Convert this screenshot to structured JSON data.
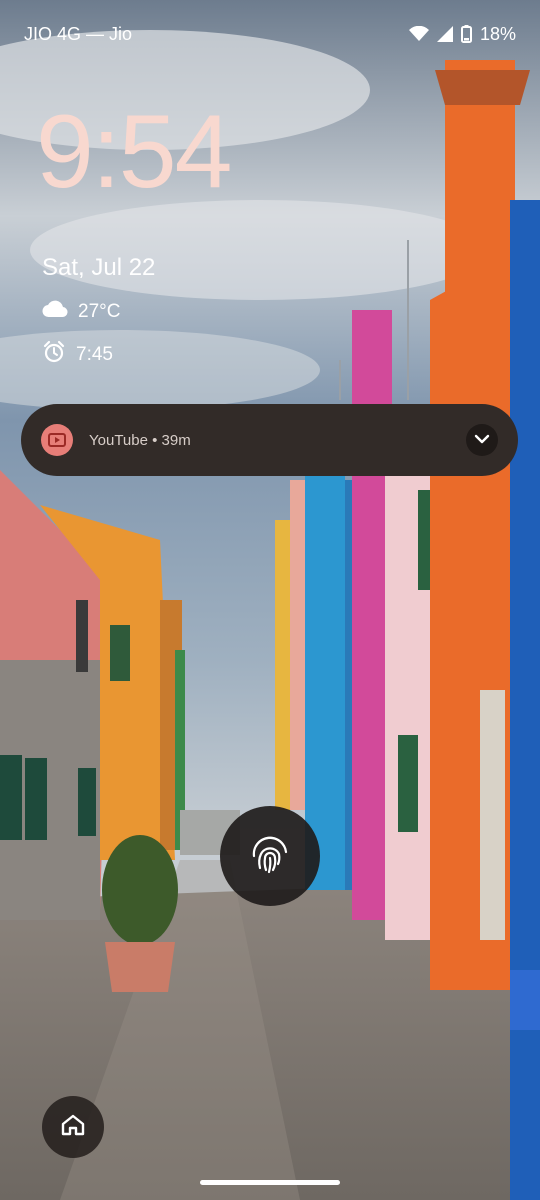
{
  "status_bar": {
    "carrier": "JIO 4G — Jio",
    "battery": "18%"
  },
  "lock_screen": {
    "time": "9:54",
    "date": "Sat, Jul 22",
    "weather": "27°C",
    "alarm": "7:45"
  },
  "notification": {
    "app": "YouTube",
    "separator": " • ",
    "age": "39m"
  },
  "icons": {
    "wifi": "wifi-icon",
    "signal": "signal-icon",
    "battery": "battery-icon",
    "cloud": "cloud-icon",
    "alarm": "alarm-icon",
    "fingerprint": "fingerprint-icon",
    "home": "home-icon",
    "expand": "chevron-down-icon"
  },
  "colors": {
    "clock": "#f8d8cf",
    "notification_bg": "#322b28",
    "app_icon_bg": "#e77e78"
  }
}
